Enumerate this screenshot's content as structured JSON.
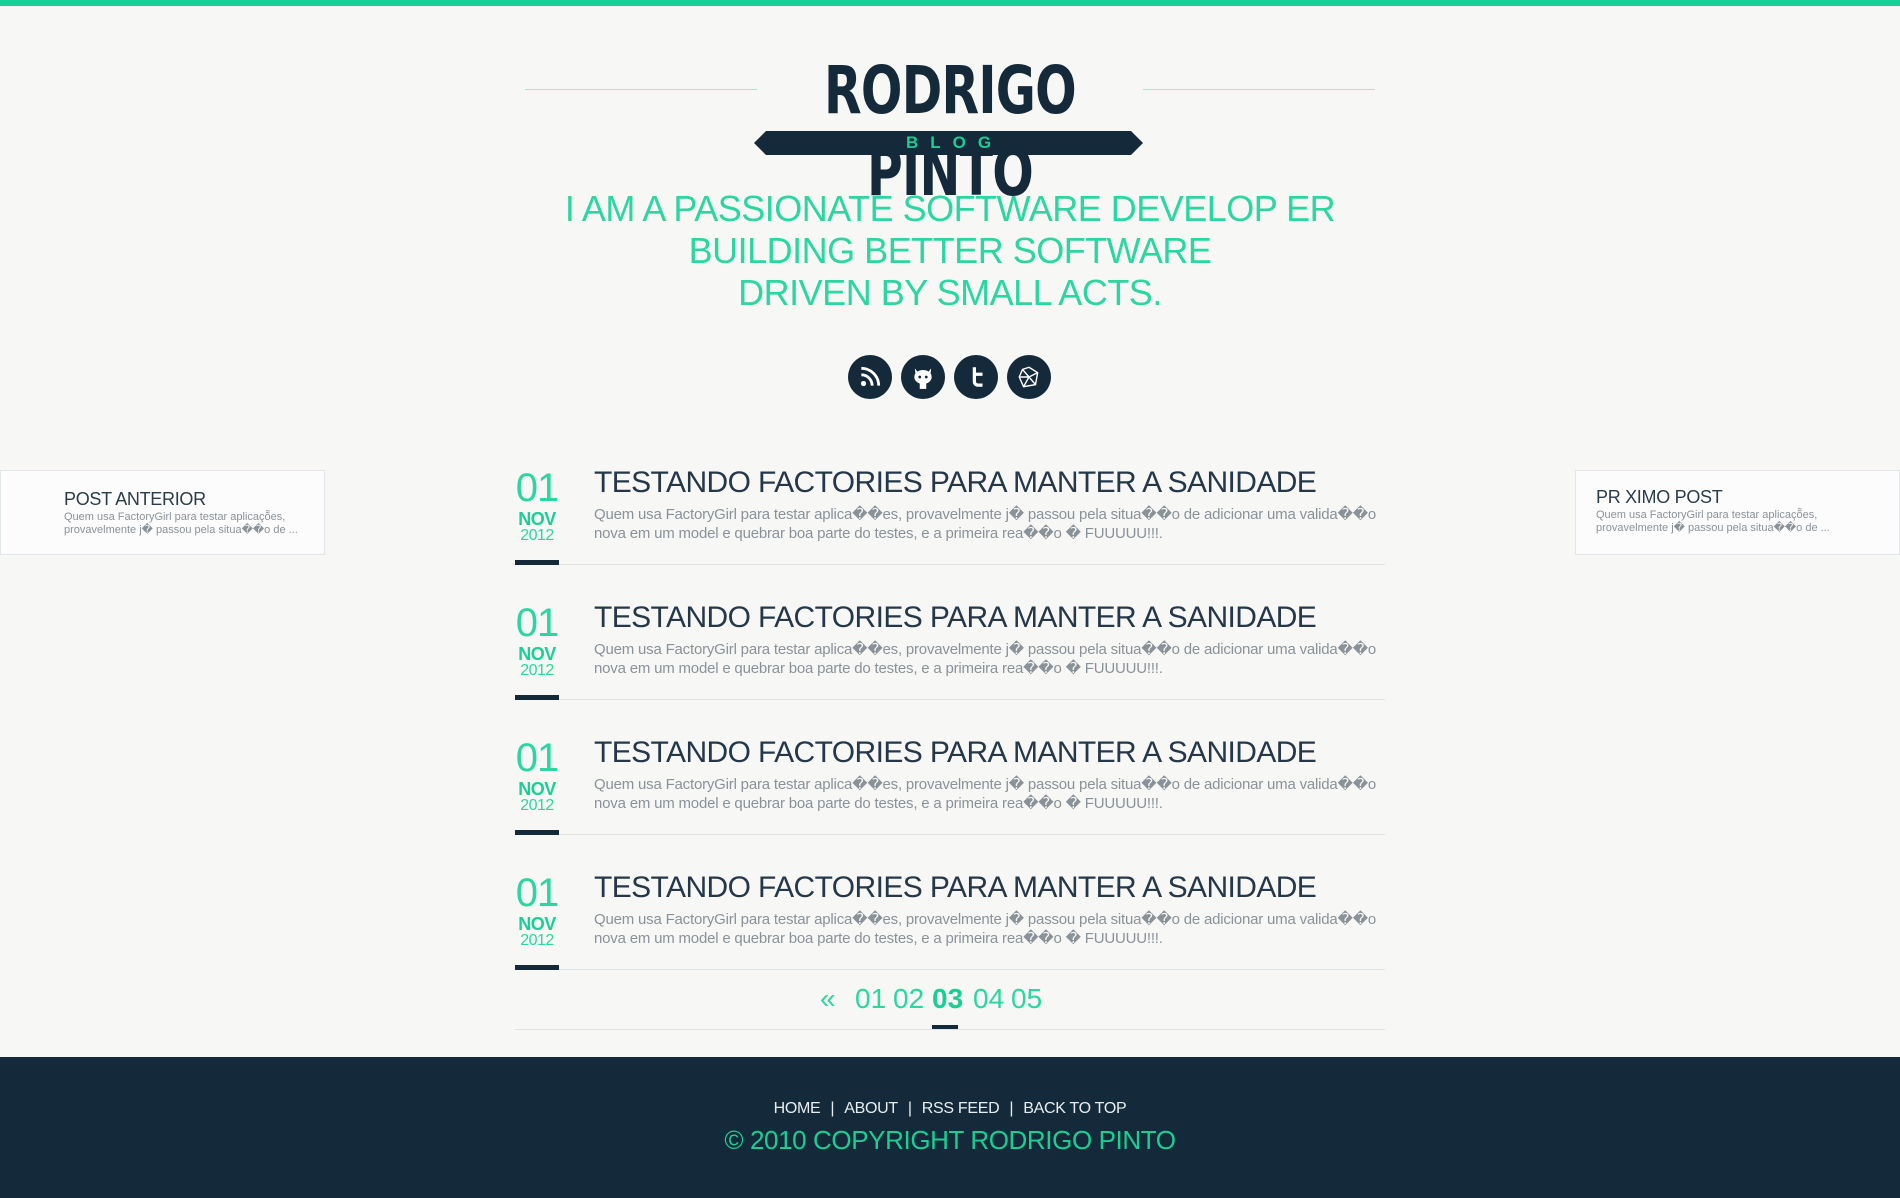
{
  "colors": {
    "accent": "#19cf94",
    "navy": "#142a3a",
    "text_muted": "#8a9299"
  },
  "header": {
    "name": "RODRIGO PINTO",
    "subtitle": "BLOG"
  },
  "tagline": {
    "line1": "I AM A PASSIONATE SOFTWARE DEVELOP ER",
    "line2": "BUILDING BETTER SOFTWARE",
    "line3": "DRIVEN BY SMALL ACTS."
  },
  "social": [
    {
      "icon": "rss-icon"
    },
    {
      "icon": "github-icon"
    },
    {
      "icon": "twitter-icon"
    },
    {
      "icon": "ruby-icon"
    }
  ],
  "nav": {
    "prev": {
      "title": "POST ANTERIOR",
      "excerpt": "Quem usa FactoryGirl para testar aplicaçõ̃es, provavelmente j� passou pela situa��o de ..."
    },
    "next": {
      "title": "PR XIMO POST",
      "excerpt": "Quem usa FactoryGirl para testar aplicaçõ̃es, provavelmente j� passou pela situa��o de ..."
    }
  },
  "posts": [
    {
      "day": "01",
      "month": "NOV",
      "year": "2012",
      "title": "TESTANDO FACTORIES PARA MANTER A SANIDADE",
      "excerpt": "Quem usa FactoryGirl para testar aplica��es, provavelmente j� passou pela situa��o de adicionar uma valida��o nova em um model e quebrar boa parte do testes, e a primeira rea��o � FUUUUU!!!."
    },
    {
      "day": "01",
      "month": "NOV",
      "year": "2012",
      "title": "TESTANDO FACTORIES PARA MANTER A SANIDADE",
      "excerpt": "Quem usa FactoryGirl para testar aplica��es, provavelmente j� passou pela situa��o de adicionar uma valida��o nova em um model e quebrar boa parte do testes, e a primeira rea��o � FUUUUU!!!."
    },
    {
      "day": "01",
      "month": "NOV",
      "year": "2012",
      "title": "TESTANDO FACTORIES PARA MANTER A SANIDADE",
      "excerpt": "Quem usa FactoryGirl para testar aplica��es, provavelmente j� passou pela situa��o de adicionar uma valida��o nova em um model e quebrar boa parte do testes, e a primeira rea��o � FUUUUU!!!."
    },
    {
      "day": "01",
      "month": "NOV",
      "year": "2012",
      "title": "TESTANDO FACTORIES PARA MANTER A SANIDADE",
      "excerpt": "Quem usa FactoryGirl para testar aplica��es, provavelmente j� passou pela situa��o de adicionar uma valida��o nova em um model e quebrar boa parte do testes, e a primeira rea��o � FUUUUU!!!."
    }
  ],
  "pagination": {
    "prev": "«",
    "pages": [
      "01",
      "02",
      "03",
      "04",
      "05"
    ],
    "current": "03"
  },
  "footer": {
    "links": [
      "HOME",
      "ABOUT",
      "RSS FEED",
      "BACK TO TOP"
    ],
    "separator": "|",
    "copyright": "© 2010 COPYRIGHT RODRIGO PINTO"
  }
}
